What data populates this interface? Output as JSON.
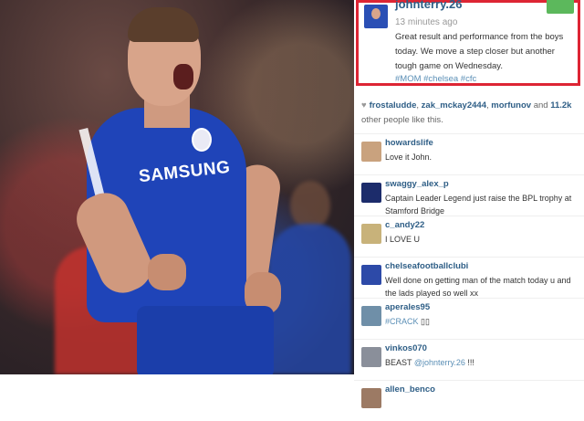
{
  "post": {
    "username": "johnterry.26",
    "time": "13 minutes ago",
    "follow_label": "",
    "caption": "Great result and performance from the boys today. We move a step closer but another tough game on Wednesday.",
    "tags": "#MOM #chelsea #cfc"
  },
  "photo": {
    "sponsor": "SAMSUNG"
  },
  "likes": {
    "users": [
      "frostaludde",
      "zak_mckay2444",
      "morfunov"
    ],
    "and": "and",
    "count": "11.2k",
    "suffix": "other people like this."
  },
  "comments": [
    {
      "user": "howardslife",
      "text": "Love it John.",
      "avatar_color": "#c9a27e"
    },
    {
      "user": "swaggy_alex_p",
      "text": "Captain Leader Legend just raise the BPL trophy at Stamford Bridge",
      "avatar_color": "#1c2c6b"
    },
    {
      "user": "c_andy22",
      "text": "I LOVE U",
      "avatar_color": "#c8b27a"
    },
    {
      "user": "chelseafootballclubi",
      "text": "Well done on getting man of the match today u and the lads played so well xx",
      "avatar_color": "#2d4aa8"
    },
    {
      "user": "aperales95",
      "text": "#CRACK",
      "avatar_color": "#6f8fa8"
    },
    {
      "user": "vinkos070",
      "text_prefix": "BEAST",
      "text_link": "@johnterry.26",
      "text_suffix": "!!!",
      "avatar_color": "#8a8f9a"
    },
    {
      "user": "allen_benco",
      "text": "",
      "avatar_color": "#9c7a64"
    }
  ]
}
